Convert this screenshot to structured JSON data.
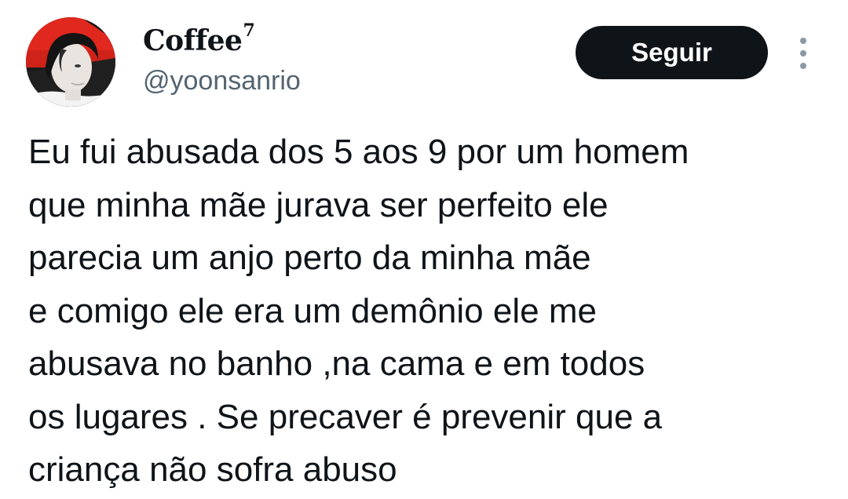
{
  "author": {
    "display_name": "Coffee",
    "name_superscript": "7",
    "handle": "@yoonsanrio",
    "avatar_icon": "user-avatar-photo"
  },
  "actions": {
    "follow_label": "Seguir",
    "more_icon": "more-vertical-icon"
  },
  "tweet": {
    "lines": [
      "Eu fui abusada dos 5 aos 9 por um homem",
      "que minha mãe jurava ser perfeito ele",
      "parecia um anjo perto da minha mãe",
      "e comigo ele era um demônio ele me",
      "abusava no banho ,na cama e em todos",
      "os lugares . Se precaver é prevenir que a",
      "criança não sofra abuso"
    ]
  },
  "colors": {
    "text_primary": "#0f1419",
    "text_secondary": "#536471",
    "button_bg": "#0f1419",
    "button_text": "#ffffff",
    "icon_gray": "#8b98a5",
    "avatar_accent": "#e0281e"
  }
}
